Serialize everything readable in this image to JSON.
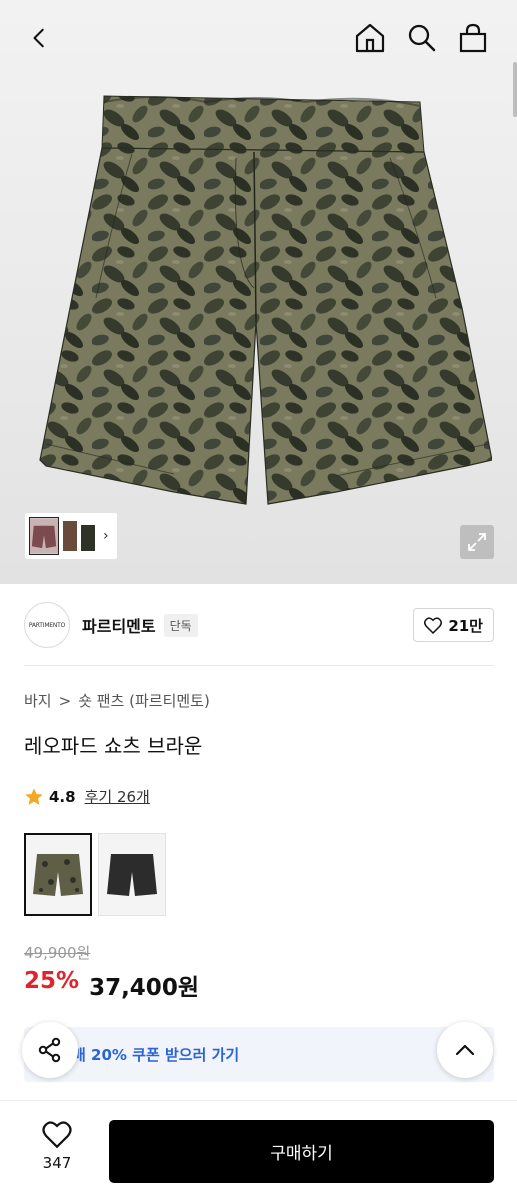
{
  "header": {
    "back_icon": "chevron-left-icon",
    "home_icon": "home-icon",
    "search_icon": "search-icon",
    "bag_icon": "shopping-bag-icon"
  },
  "gallery": {
    "expand_icon": "expand-icon",
    "thumb_next_icon": "chevron-right-icon",
    "thumb_next": "›"
  },
  "brand": {
    "logo_text": "PARTIMENTO",
    "name": "파르티멘토",
    "badge": "단독",
    "like_count": "21만"
  },
  "breadcrumb": {
    "category": "바지",
    "separator": ">",
    "subcategory": "숏 팬츠 (파르티멘토)"
  },
  "product": {
    "title": "레오파드 쇼츠 브라운",
    "rating": "4.8",
    "review_link": "후기 26개"
  },
  "price": {
    "original": "49,900원",
    "discount_rate": "25%",
    "sale": "37,400원"
  },
  "coupon": {
    "text": "매 20% 쿠폰 받으러 가기"
  },
  "bottom": {
    "wish_count": "347",
    "buy_label": "구매하기"
  },
  "colors": {
    "discount_red": "#e0242e",
    "coupon_blue": "#2a64d6",
    "buy_button": "#000000",
    "star": "#f5a623"
  }
}
